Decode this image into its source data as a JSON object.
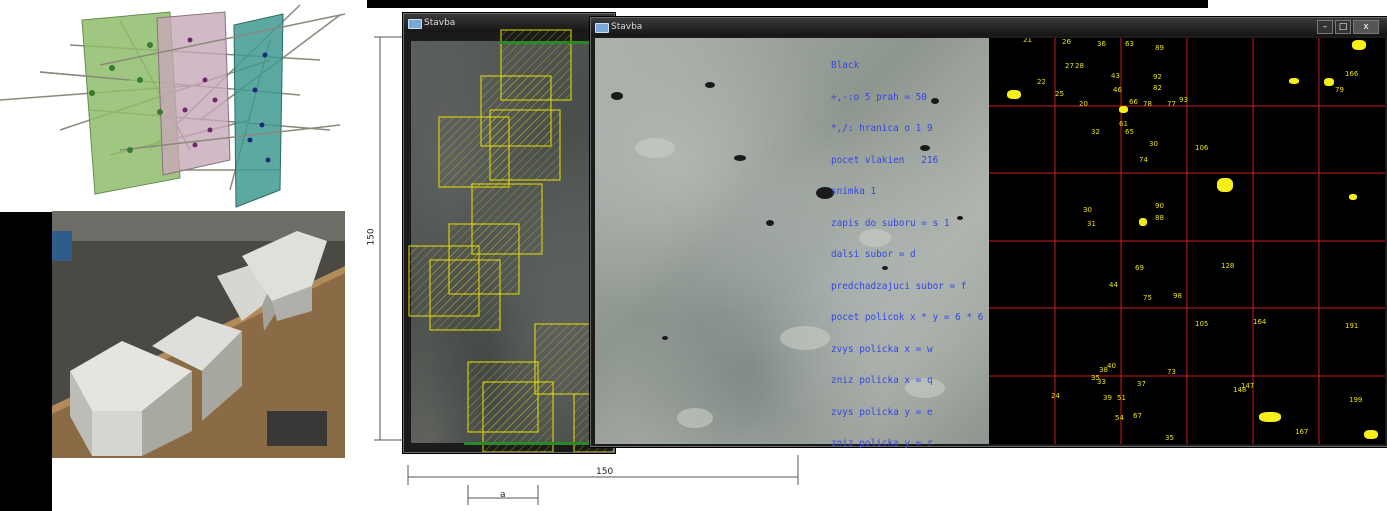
{
  "window_back": {
    "title": "Stavba"
  },
  "window_front": {
    "title": "Stavba",
    "controls": {
      "minimize": "–",
      "maximize": "□",
      "close": "x"
    }
  },
  "overlay_lines": [
    "Black",
    "+,-:o 5 prah = 50",
    "*,/: hranica o 1 9",
    "pocet vlakien   216",
    "snimka 1",
    "zapis do suboru = s 1",
    "dalsi subor = d",
    "predchadzajuci subor = f",
    "pocet policok x * y = 6 * 6",
    "zvys policka x = w",
    "zniz policka x = q",
    "zvys policka y = e",
    "zniz policka y = r"
  ],
  "fiber_labels": [
    "21",
    "26",
    "36",
    "63",
    "89",
    "27",
    "28",
    "43",
    "92",
    "46",
    "82",
    "78",
    "22",
    "25",
    "20",
    "66",
    "77",
    "93",
    "32",
    "61",
    "65",
    "30",
    "106",
    "74",
    "30",
    "90",
    "31",
    "71",
    "88",
    "69",
    "128",
    "44",
    "75",
    "98",
    "105",
    "164",
    "191",
    "40",
    "38",
    "35",
    "33",
    "37",
    "73",
    "24",
    "39",
    "51",
    "54",
    "67",
    "35",
    "167",
    "199",
    "79",
    "166",
    "148",
    "147"
  ],
  "dimensions": {
    "vertical": "150",
    "horizontal": "150",
    "cell": "a"
  },
  "colors": {
    "grid_red": "#d11a1a",
    "fiber_yellow": "#f6ef1a",
    "overlay_blue": "#3447e6",
    "selection_yellow": "#e8e000"
  }
}
